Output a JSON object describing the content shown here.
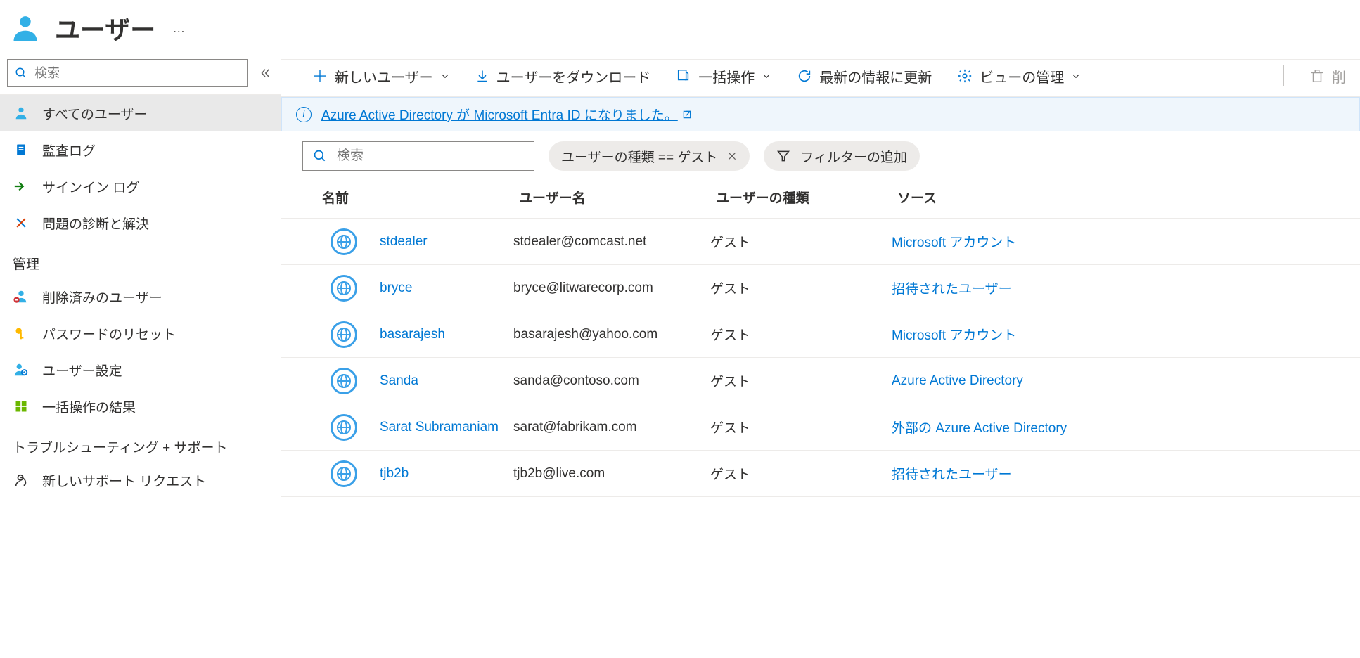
{
  "header": {
    "title": "ユーザー",
    "more": "…"
  },
  "sidebar": {
    "search_placeholder": "検索",
    "items": [
      {
        "label": "すべてのユーザー"
      },
      {
        "label": "監査ログ"
      },
      {
        "label": "サインイン ログ"
      },
      {
        "label": "問題の診断と解決"
      }
    ],
    "section_manage": "管理",
    "manage_items": [
      {
        "label": "削除済みのユーザー"
      },
      {
        "label": "パスワードのリセット"
      },
      {
        "label": "ユーザー設定"
      },
      {
        "label": "一括操作の結果"
      }
    ],
    "section_support": "トラブルシューティング + サポート",
    "support_items": [
      {
        "label": "新しいサポート リクエスト"
      }
    ]
  },
  "toolbar": {
    "new_user": "新しいユーザー",
    "download": "ユーザーをダウンロード",
    "bulk": "一括操作",
    "refresh": "最新の情報に更新",
    "manage_view": "ビューの管理",
    "delete": "削"
  },
  "infobar": {
    "text": "Azure Active Directory が Microsoft Entra ID になりました。"
  },
  "filters": {
    "search_placeholder": "検索",
    "user_type_pill": "ユーザーの種類 == ゲスト",
    "add_filter": "フィルターの追加"
  },
  "table": {
    "columns": {
      "name": "名前",
      "username": "ユーザー名",
      "type": "ユーザーの種類",
      "source": "ソース"
    },
    "rows": [
      {
        "name": "stdealer",
        "username": "stdealer@comcast.net",
        "type": "ゲスト",
        "source": "Microsoft アカウント"
      },
      {
        "name": "bryce",
        "username": "bryce@litwarecorp.com",
        "type": "ゲスト",
        "source": "招待されたユーザー"
      },
      {
        "name": "basarajesh",
        "username": "basarajesh@yahoo.com",
        "type": "ゲスト",
        "source": "Microsoft アカウント"
      },
      {
        "name": "Sanda",
        "username": "sanda@contoso.com",
        "type": "ゲスト",
        "source": "Azure Active Directory"
      },
      {
        "name": "Sarat Subramaniam",
        "username": "sarat@fabrikam.com",
        "type": "ゲスト",
        "source": "外部の Azure Active Directory"
      },
      {
        "name": "tjb2b",
        "username": "tjb2b@live.com",
        "type": "ゲスト",
        "source": "招待されたユーザー"
      }
    ]
  }
}
